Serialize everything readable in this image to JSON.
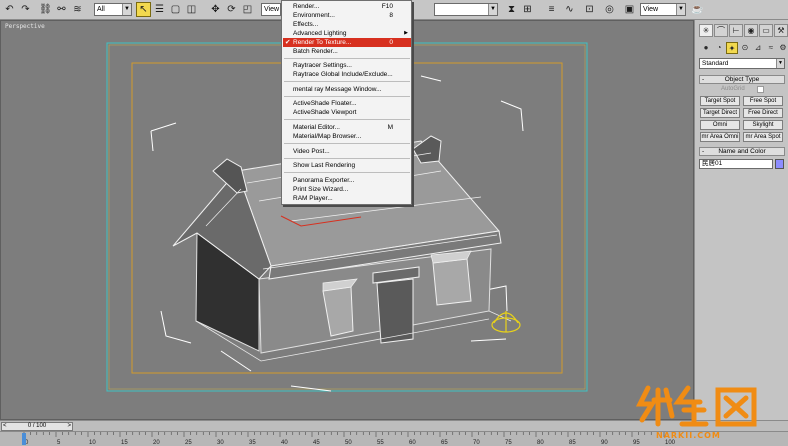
{
  "toolbar": {
    "selection_filter": "All",
    "coord_system": "View",
    "named_selection": "",
    "view_dropdown": "View",
    "icons": [
      "undo-icon",
      "redo-icon",
      "select-and-link-icon",
      "unlink-icon",
      "bind-to-space-warp-icon",
      "select-object-icon",
      "select-by-name-icon",
      "rectangular-selection-icon",
      "window-crossing-icon",
      "select-and-move-icon",
      "select-and-rotate-icon",
      "select-and-scale-icon",
      "mirror-icon",
      "align-icon",
      "layer-manager-icon",
      "curve-editor-icon",
      "schematic-view-icon",
      "material-editor-icon",
      "render-scene-icon",
      "quick-render-icon"
    ]
  },
  "viewport": {
    "label": "Perspective"
  },
  "render_menu": {
    "items": [
      {
        "label": "Render...",
        "shortcut": "F10"
      },
      {
        "label": "Environment...",
        "shortcut": "8"
      },
      {
        "label": "Effects...",
        "shortcut": ""
      },
      {
        "label": "Advanced Lighting",
        "shortcut": "",
        "submenu": "▶"
      },
      {
        "label": "Render To Texture...",
        "shortcut": "0",
        "check": "✔"
      },
      {
        "label": "Batch Render...",
        "shortcut": ""
      },
      {
        "label": "Raytracer Settings...",
        "shortcut": ""
      },
      {
        "label": "Raytrace Global Include/Exclude...",
        "shortcut": ""
      },
      {
        "label": "mental ray Message Window...",
        "shortcut": ""
      },
      {
        "label": "ActiveShade Floater...",
        "shortcut": ""
      },
      {
        "label": "ActiveShade Viewport",
        "shortcut": ""
      },
      {
        "label": "Material Editor...",
        "shortcut": "M"
      },
      {
        "label": "Material/Map Browser...",
        "shortcut": ""
      },
      {
        "label": "Video Post...",
        "shortcut": ""
      },
      {
        "label": "Show Last Rendering",
        "shortcut": ""
      },
      {
        "label": "Panorama Exporter...",
        "shortcut": ""
      },
      {
        "label": "Print Size Wizard...",
        "shortcut": ""
      },
      {
        "label": "RAM Player...",
        "shortcut": ""
      }
    ]
  },
  "command_panel": {
    "tabs": [
      "create-tab",
      "modify-tab",
      "hierarchy-tab",
      "motion-tab",
      "display-tab",
      "utilities-tab"
    ],
    "category_dropdown": "Standard",
    "object_type": {
      "header": "Object Type",
      "autogrid": "AutoGrid",
      "buttons": [
        "Target Spot",
        "Free Spot",
        "Target Direct",
        "Free Direct",
        "Omni",
        "Skylight",
        "mr Area Omni",
        "mr Area Spot"
      ]
    },
    "name_and_color": {
      "header": "Name and Color",
      "name": "民居01",
      "swatch_color": "#8d8dff"
    },
    "collapse_symbol": "-"
  },
  "timeline": {
    "slider_label": "0 / 100",
    "prev_arrow": "<",
    "next_arrow": ">",
    "ticks": [
      "0",
      "5",
      "10",
      "15",
      "20",
      "25",
      "30",
      "35",
      "40",
      "45",
      "50",
      "55",
      "60",
      "65",
      "70",
      "75",
      "80",
      "85",
      "90",
      "95",
      "100"
    ]
  },
  "watermark": {
    "text": "NARKII.COM"
  },
  "colors": {
    "toolbar_bg": "#c6c6c6",
    "viewport_bg": "#7d7d7d",
    "menu_highlight": "#d7301f",
    "safe_frame_cyan": "#3fc4c4",
    "safe_frame_orange": "#d29a2a",
    "selection_yellow": "#f2d94e",
    "watermark_orange": "#f08c14"
  }
}
